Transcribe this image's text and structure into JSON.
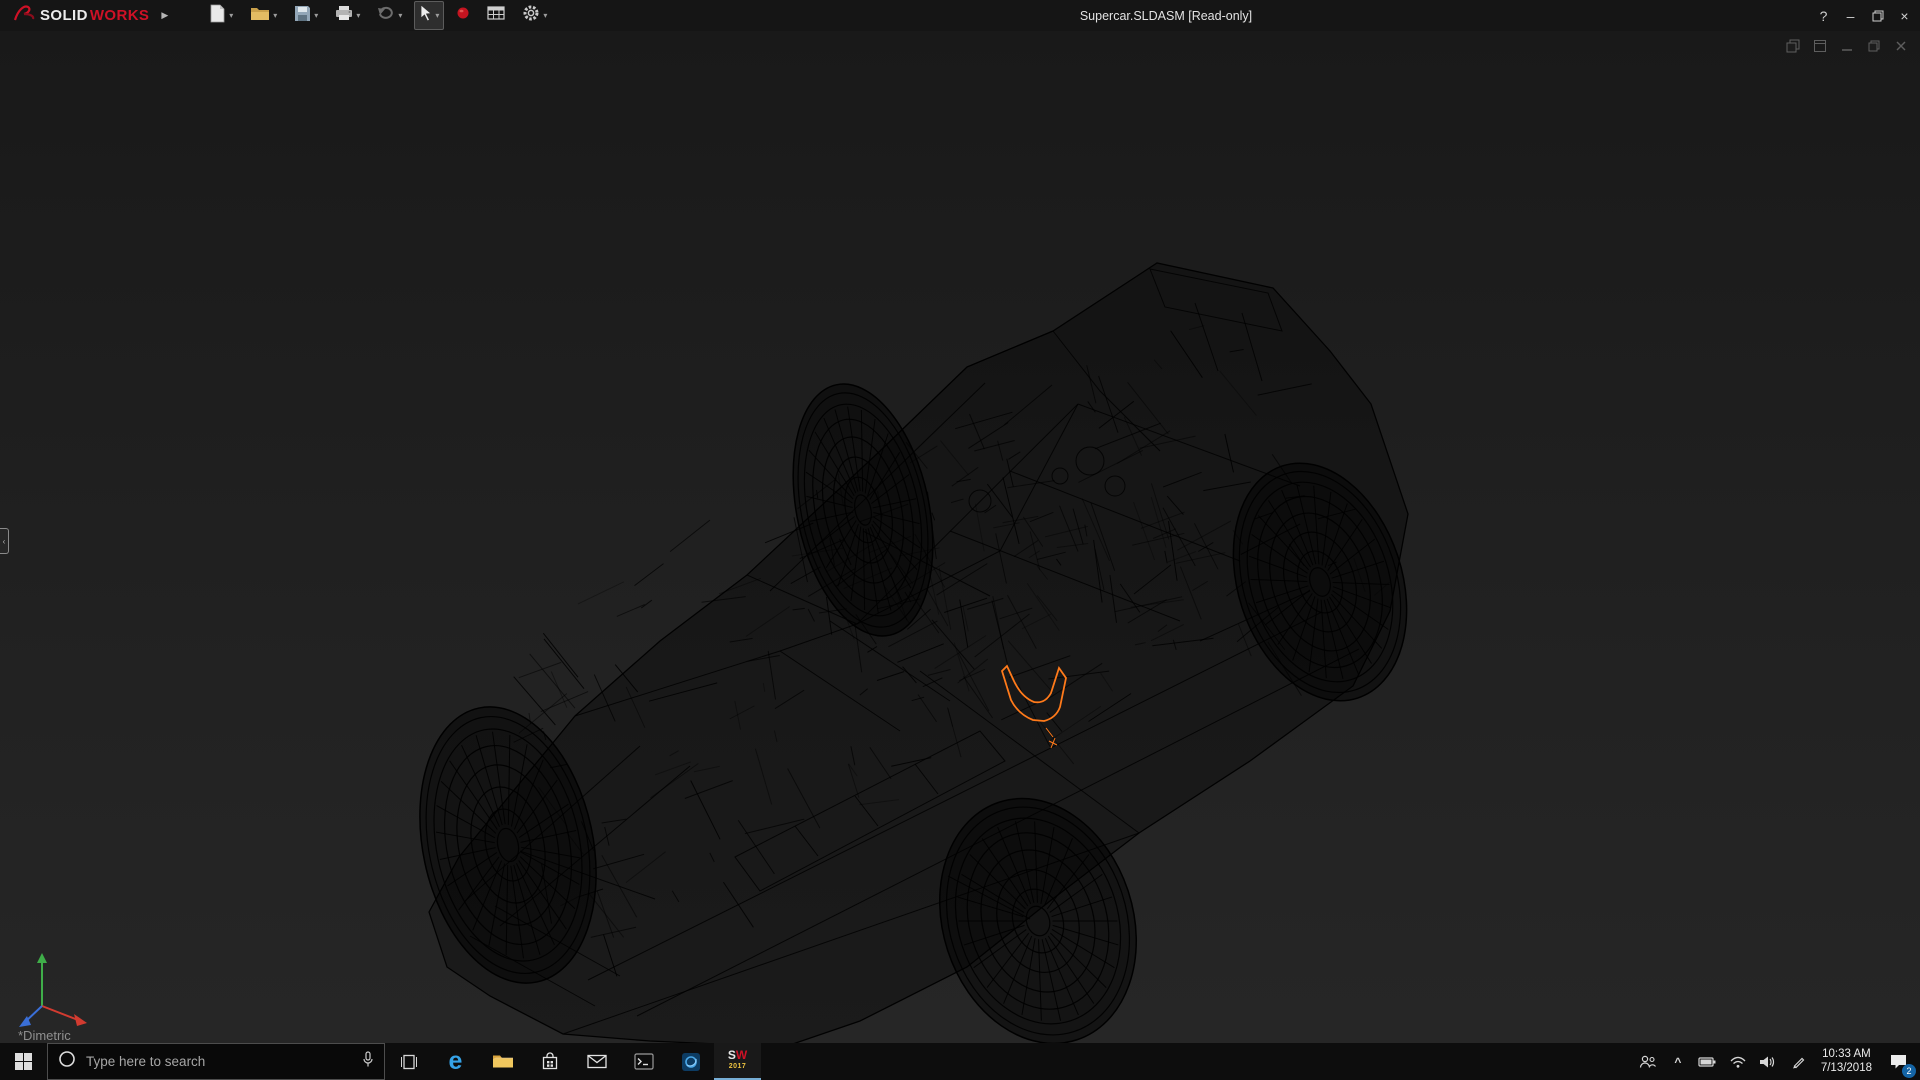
{
  "titlebar": {
    "logo_solid": "SOLID",
    "logo_works": "WORKS",
    "flyout_glyph": "▶",
    "dropdown_glyph": "▾",
    "title": "Supercar.SLDASM [Read-only]",
    "help_glyph": "?",
    "minimize_glyph": "–",
    "close_glyph": "×"
  },
  "viewport": {
    "view_orientation_label": "*Dimetric",
    "collapse_tab_glyph": "‹"
  },
  "taskbar": {
    "search_placeholder": "Type here to search",
    "edge_glyph": "e",
    "sw_s": "S",
    "sw_w": "W",
    "sw_year": "2017",
    "hidden_icons_glyph": "^",
    "clock_time": "10:33 AM",
    "clock_date": "7/13/2018",
    "notification_badge": "2"
  },
  "colors": {
    "highlight_orange": "#ff7a1a",
    "logo_red": "#cf1126",
    "edge_blue": "#35a3e8",
    "badge_blue": "#1464a5"
  }
}
